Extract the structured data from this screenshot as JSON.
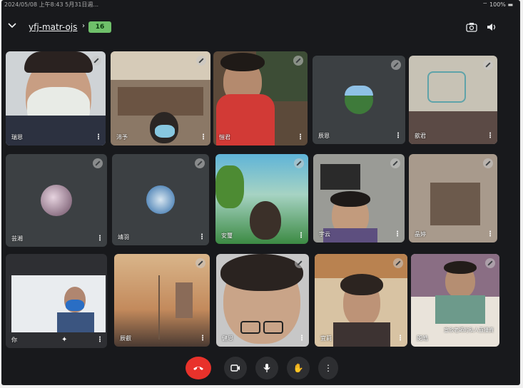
{
  "status_bar": {
    "time": "2024/05/08 上午8:43 5月31日週...",
    "battery": "100%"
  },
  "meeting": {
    "code": "yfj-matr-ojs",
    "participant_count": "16"
  },
  "tiles": [
    {
      "name": "瑞恩"
    },
    {
      "name": "沛予"
    },
    {
      "name": "愷君"
    },
    {
      "name": "辰恩"
    },
    {
      "name": "歆君"
    },
    {
      "name": "芸湘"
    },
    {
      "name": "靖羽"
    },
    {
      "name": "安璽"
    },
    {
      "name": "宇云"
    },
    {
      "name": "晶婷"
    },
    {
      "name": "你"
    },
    {
      "name": "辰叡"
    },
    {
      "name": "健恩"
    },
    {
      "name": "宜莉"
    },
    {
      "name": "閔皓"
    }
  ],
  "extra_label": "宜欣老師的私人直播資",
  "colors": {
    "background": "#18191c",
    "tile": "#3c4043",
    "hangup": "#e8322b",
    "badge": "#6fc06a"
  }
}
